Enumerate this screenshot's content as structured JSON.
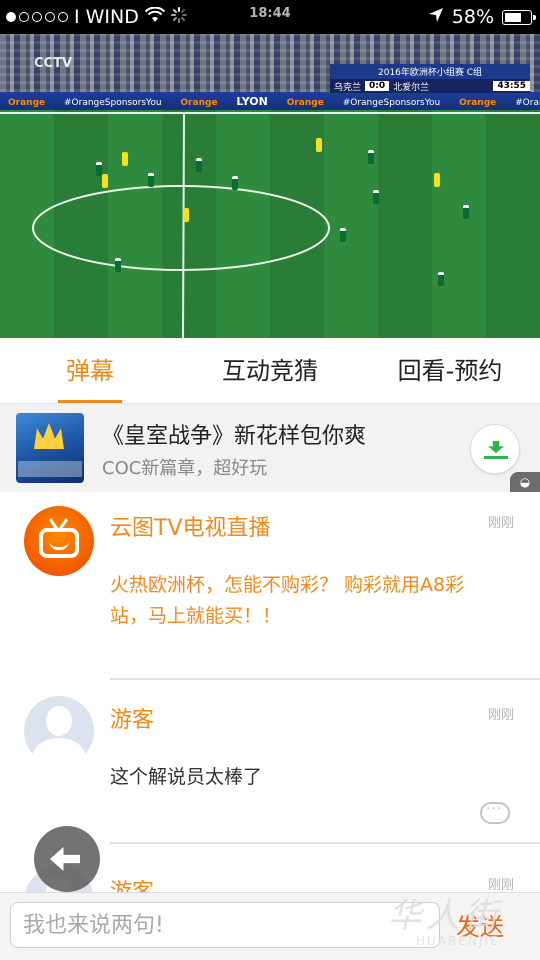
{
  "status_bar": {
    "carrier": "I WIND",
    "time": "18:44",
    "battery": "58%",
    "signal_dots_full": 1,
    "signal_dots_total": 5
  },
  "video": {
    "channel_logo": "CCTV",
    "banner_text": "LYON",
    "ad_text_1": "Orange",
    "ad_text_2": "#OrangeSponsorsYou",
    "scoreboard": {
      "title": "2016年欧洲杯小组赛 C组",
      "team_left": "乌克兰",
      "score": "0:0",
      "team_right": "北爱尔兰",
      "clock": "43:55"
    }
  },
  "tabs": [
    {
      "label": "弹幕",
      "active": true
    },
    {
      "label": "互动竞猜",
      "active": false
    },
    {
      "label": "回看-预约",
      "active": false
    }
  ],
  "ad": {
    "title": "《皇室战争》新花样包你爽",
    "subtitle": "COC新篇章，超好玩"
  },
  "messages": [
    {
      "name": "云图TV电视直播",
      "time": "刚刚",
      "text": "火热欧洲杯，怎能不购彩？ 购彩就用A8彩站，马上就能买！！"
    },
    {
      "name": "游客",
      "time": "刚刚",
      "text": "这个解说员太棒了"
    },
    {
      "name": "游客",
      "time": "刚刚",
      "text": ""
    }
  ],
  "input": {
    "placeholder": "我也来说两句!",
    "send_label": "发送"
  },
  "watermark": {
    "cn": "华人街",
    "en": "HUARENJIE"
  }
}
